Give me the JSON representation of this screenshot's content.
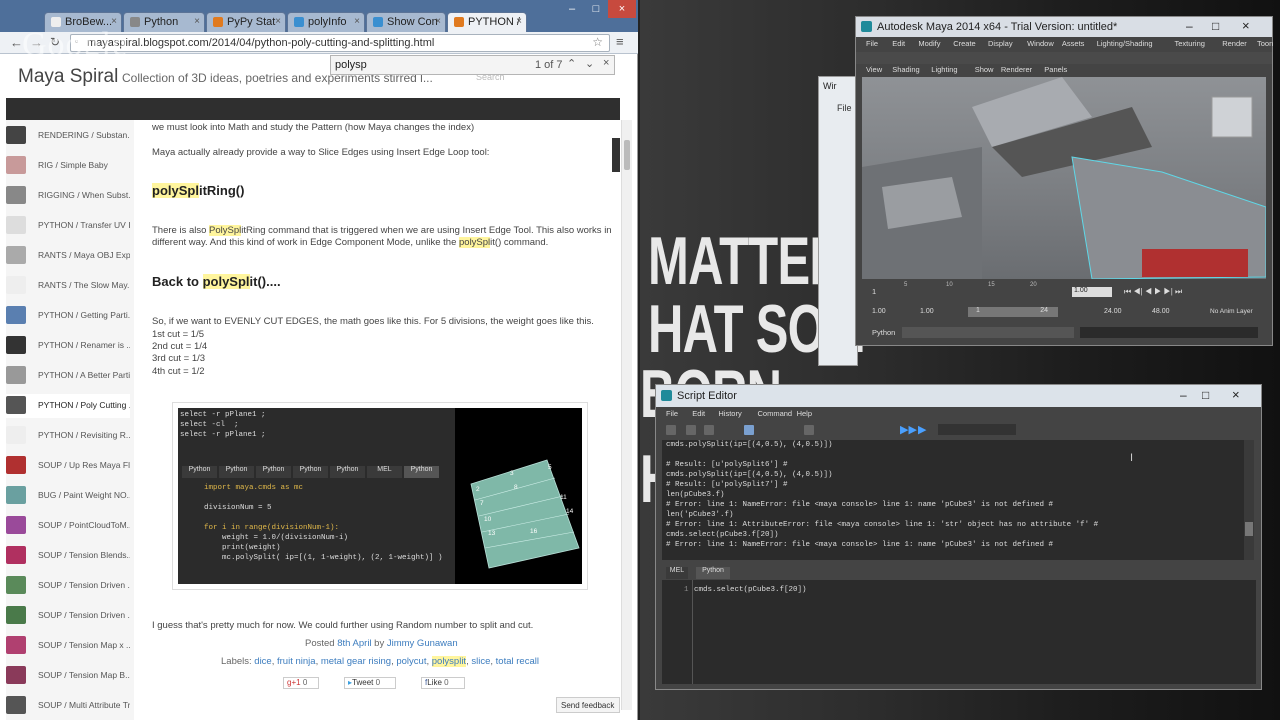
{
  "browser": {
    "tabs": [
      {
        "label": "BroBew..."
      },
      {
        "label": "Python"
      },
      {
        "label": "PyPy Stat"
      },
      {
        "label": "polyInfo"
      },
      {
        "label": "Show Con"
      },
      {
        "label": "PYTHON /",
        "active": true
      }
    ],
    "url": "mayaspiral.blogspot.com/2014/04/python-poly-cutting-and-splitting.html",
    "find": {
      "query": "polysp",
      "count": "1 of 7"
    },
    "watermark": "Google"
  },
  "blog": {
    "title": "Maya Spiral",
    "tagline": "Collection of 3D ideas, poetries and experiments stirred l...",
    "search_placeholder": "Search"
  },
  "sidebar": [
    {
      "label": "RENDERING / Substan...",
      "color": "#444"
    },
    {
      "label": "RIG / Simple Baby",
      "color": "#c89a9a"
    },
    {
      "label": "RIGGING / When Subst...",
      "color": "#888"
    },
    {
      "label": "PYTHON / Transfer UV I...",
      "color": "#ddd"
    },
    {
      "label": "RANTS / Maya OBJ Exp...",
      "color": "#aaa"
    },
    {
      "label": "RANTS / The Slow May...",
      "color": "#eee"
    },
    {
      "label": "PYTHON / Getting Parti...",
      "color": "#5a7fb0"
    },
    {
      "label": "PYTHON / Renamer is ...",
      "color": "#333"
    },
    {
      "label": "PYTHON / A Better Parti...",
      "color": "#999"
    },
    {
      "label": "PYTHON / Poly Cutting ...",
      "color": "#555",
      "active": true
    },
    {
      "label": "PYTHON / Revisiting R...",
      "color": "#eee"
    },
    {
      "label": "SOUP / Up Res Maya Fl...",
      "color": "#b03030"
    },
    {
      "label": "BUG / Paint Weight NO...",
      "color": "#6aa0a0"
    },
    {
      "label": "SOUP / PointCloudToM...",
      "color": "#9a4a9a"
    },
    {
      "label": "SOUP / Tension Blends...",
      "color": "#b03060"
    },
    {
      "label": "SOUP / Tension Driven ...",
      "color": "#5a8a5a"
    },
    {
      "label": "SOUP / Tension Driven ...",
      "color": "#4a7a4a"
    },
    {
      "label": "SOUP / Tension Map x ...",
      "color": "#b04070"
    },
    {
      "label": "SOUP / Tension Map B...",
      "color": "#8a3a5a"
    },
    {
      "label": "SOUP / Multi Attribute Tr...",
      "color": "#555"
    }
  ],
  "article": {
    "p1": "we must look into Math and study the Pattern (how Maya changes the index)",
    "p2": "Maya actually already provide a way to Slice Edges using Insert Edge Loop tool:",
    "h1_hl": "polySpl",
    "h1_rest": "itRing()",
    "p3_a": "There is also ",
    "p3_hl1": "PolySpl",
    "p3_b": "itRing command that is triggered when we are using Insert Edge Tool. This also works in different way. And this kind of work in Edge Component Mode, unlike the ",
    "p3_hl2": "polySpl",
    "p3_c": "it() command.",
    "h2_a": "Back to ",
    "h2_hl": "polySpl",
    "h2_b": "it()....",
    "p4": "So, if we want to EVENLY CUT EDGES, the math goes like this. For 5 divisions, the weight goes like this.",
    "cuts": [
      "1st cut = 1/5",
      "2nd cut = 1/4",
      "3rd cut = 1/3",
      "4th cut = 1/2"
    ],
    "p5": "I guess that's pretty much for now. We could further using Random number to split and cut.",
    "posted_prefix": "Posted ",
    "posted_date": "8th April",
    "posted_by": " by ",
    "author": "Jimmy Gunawan",
    "labels_prefix": "Labels: ",
    "labels": [
      "dice",
      "fruit ninja",
      "metal gear rising",
      "polycut",
      "polysplit",
      "slice",
      "total recall"
    ],
    "share": {
      "gplus": "g+1",
      "gplus_count": "0",
      "tweet": "Tweet",
      "tweet_count": "0",
      "like": "Like",
      "like_count": "0"
    },
    "feedback": "Send feedback"
  },
  "code_image": {
    "top_lines": [
      "select -r pPlane1 ;",
      "select -cl  ;",
      "select -r pPlane1 ;"
    ],
    "tabs": [
      "Python",
      "Python",
      "Python",
      "Python",
      "Python",
      "MEL",
      "Python"
    ],
    "code_lines": [
      "import maya.cmds as mc",
      "",
      "divisionNum = 5",
      "",
      "for i in range(divisionNum-1):",
      "    weight = 1.0/(divisionNum-i)",
      "    print(weight)",
      "    mc.polySplit( ip=[(1, 1-weight), (2, 1-weight)] )"
    ],
    "numbers": [
      "3",
      "5",
      "8",
      "11",
      "14",
      "2",
      "7",
      "10",
      "13",
      "16"
    ]
  },
  "maya": {
    "title": "Autodesk Maya 2014 x64 - Trial Version: untitled*",
    "menu": [
      "File",
      "Edit",
      "Modify",
      "Create",
      "Display",
      "Window",
      "Assets",
      "Lighting/Shading",
      "Texturing",
      "Render",
      "Toon"
    ],
    "panel_menu": [
      "View",
      "Shading",
      "Lighting",
      "Show",
      "Renderer",
      "Panels"
    ],
    "time": {
      "start": "1",
      "current": "1.00",
      "range_start": "1.00",
      "range_start2": "1.00",
      "range_inner_start": "1",
      "range_inner_end": "24",
      "range_end": "24.00",
      "end": "48.00",
      "anim_layer": "No Anim Layer"
    },
    "ticks": [
      "5",
      "10",
      "15",
      "20"
    ],
    "cmd_label": "Python",
    "behind_title": "Wir",
    "behind_menu": "File"
  },
  "script_editor": {
    "title": "Script Editor",
    "menu": [
      "File",
      "Edit",
      "History",
      "Command",
      "Help"
    ],
    "history": [
      "cmds.polySplit(ip=[(4,0.5), (4,0.5)])",
      "",
      "# Result: [u'polySplit6'] #",
      "cmds.polySplit(ip=[(4,0.5), (4,0.5)])",
      "# Result: [u'polySplit7'] #",
      "len(pCube3.f)",
      "# Error: line 1: NameError: file <maya console> line 1: name 'pCube3' is not defined #",
      "len('pCube3'.f)",
      "# Error: line 1: AttributeError: file <maya console> line 1: 'str' object has no attribute 'f' #",
      "cmds.select(pCube3.f[20])",
      "# Error: line 1: NameError: file <maya console> line 1: name 'pCube3' is not defined #"
    ],
    "tabs": [
      "MEL",
      "Python"
    ],
    "input_line_no": "1",
    "input_code": "cmds.select(pCube3.f[20])"
  },
  "poster": {
    "lines": [
      "MATTER",
      "HAT SOM",
      "BORN",
      "HO"
    ]
  }
}
